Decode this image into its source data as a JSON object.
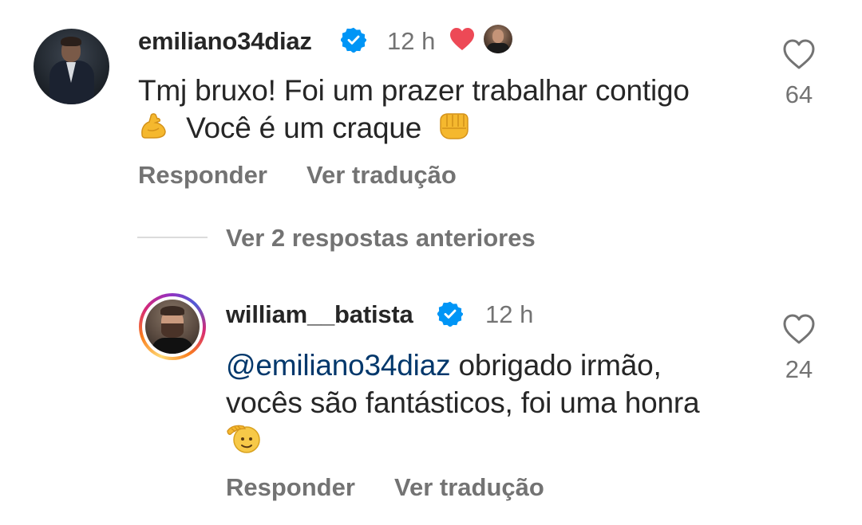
{
  "comments": [
    {
      "username": "emiliano34diaz",
      "time": "12 h",
      "text_line1": "Tmj bruxo! Foi um prazer trabalhar contigo",
      "text_line2": "Você é um craque",
      "likes": "64",
      "liked_by_author": true,
      "reply_label": "Responder",
      "translate_label": "Ver tradução"
    },
    {
      "username": "william__batista",
      "time": "12 h",
      "mention": "@emiliano34diaz",
      "text_line1": "obrigado irmão,",
      "text_line2": "vocês são fantásticos, foi uma honra",
      "likes": "24",
      "reply_label": "Responder",
      "translate_label": "Ver tradução"
    }
  ],
  "view_replies_label": "Ver 2 respostas anteriores",
  "colors": {
    "text": "#262626",
    "secondary": "#737373",
    "verified": "#0095f6",
    "heart": "#ed4956",
    "mention": "#00376b"
  }
}
